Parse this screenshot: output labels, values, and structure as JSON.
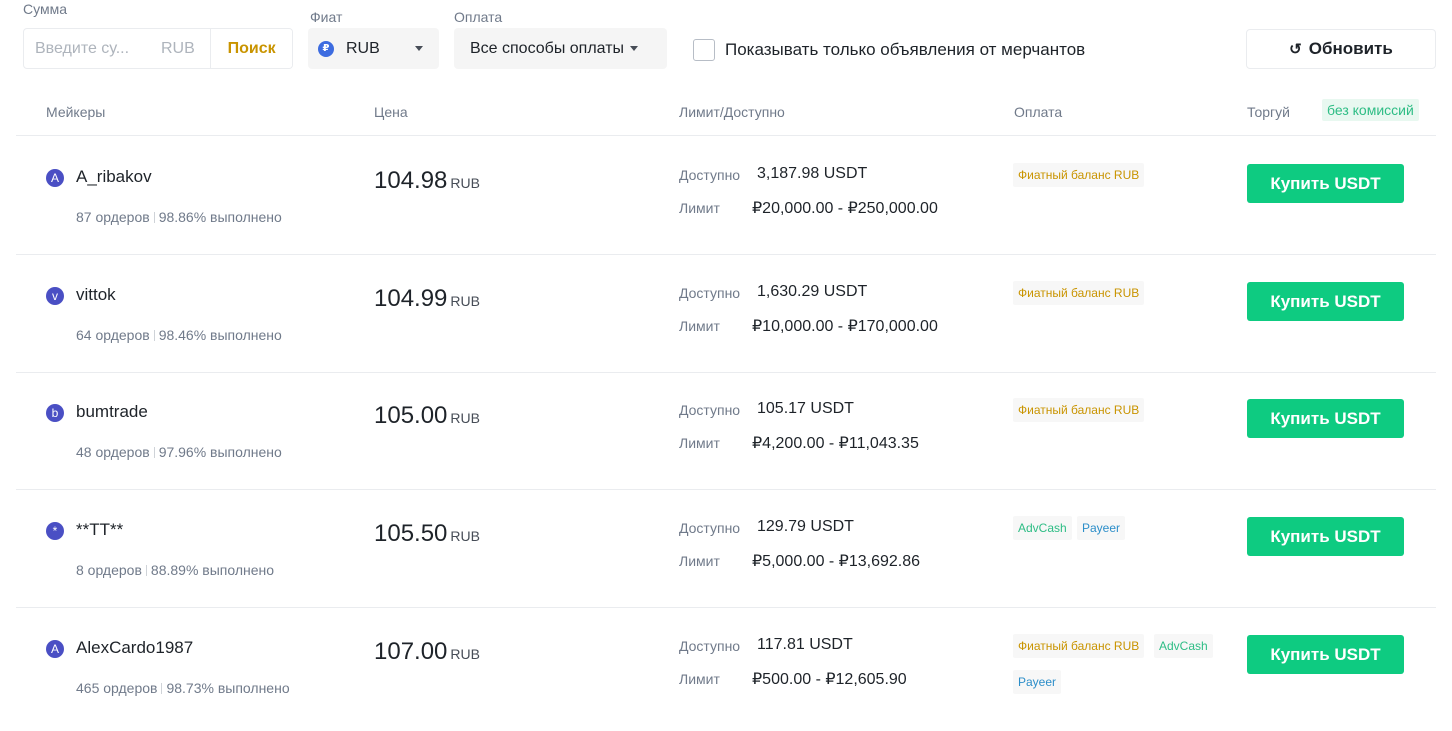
{
  "filters": {
    "amount_label": "Сумма",
    "amount_placeholder": "Введите су...",
    "amount_unit": "RUB",
    "search_label": "Поиск",
    "fiat_label": "Фиат",
    "fiat_value": "RUB",
    "fiat_icon_glyph": "₽",
    "payment_label": "Оплата",
    "payment_value": "Все способы оплаты",
    "merchant_only_label": "Показывать только объявления от мерчантов",
    "merchant_only_checked": false,
    "refresh_label": "Обновить",
    "refresh_icon": "refresh-icon"
  },
  "table": {
    "headers": {
      "makers": "Мейкеры",
      "price": "Цена",
      "limit": "Лимит/Доступно",
      "payment": "Оплата",
      "trade": "Торгуй",
      "no_fee": "без комиссий"
    },
    "available_label": "Доступно",
    "limit_label": "Лимит",
    "buy_label": "Купить USDT",
    "rows": [
      {
        "avatar": "A",
        "name": "A_ribakov",
        "orders": "87 ордеров",
        "completion": "98.86% выполнено",
        "price": "104.98",
        "currency": "RUB",
        "available": "3,187.98 USDT",
        "limit": "₽20,000.00 - ₽250,000.00",
        "payments": [
          "Фиатный баланс RUB"
        ]
      },
      {
        "avatar": "v",
        "name": "vittok",
        "orders": "64 ордеров",
        "completion": "98.46% выполнено",
        "price": "104.99",
        "currency": "RUB",
        "available": "1,630.29 USDT",
        "limit": "₽10,000.00 - ₽170,000.00",
        "payments": [
          "Фиатный баланс RUB"
        ]
      },
      {
        "avatar": "b",
        "name": "bumtrade",
        "orders": "48 ордеров",
        "completion": "97.96% выполнено",
        "price": "105.00",
        "currency": "RUB",
        "available": "105.17 USDT",
        "limit": "₽4,200.00 - ₽11,043.35",
        "payments": [
          "Фиатный баланс RUB"
        ]
      },
      {
        "avatar": "*",
        "name": "**TT**",
        "orders": "8 ордеров",
        "completion": "88.89% выполнено",
        "price": "105.50",
        "currency": "RUB",
        "available": "129.79 USDT",
        "limit": "₽5,000.00 - ₽13,692.86",
        "payments": [
          "AdvCash",
          "Payeer"
        ]
      },
      {
        "avatar": "A",
        "name": "AlexCardo1987",
        "orders": "465 ордеров",
        "completion": "98.73% выполнено",
        "price": "107.00",
        "currency": "RUB",
        "available": "117.81 USDT",
        "limit": "₽500.00 - ₽12,605.90",
        "payments": [
          "Фиатный баланс RUB",
          "AdvCash",
          "Payeer"
        ]
      }
    ]
  },
  "colors": {
    "buy_button": "#0ecb81",
    "search_accent": "#c99400",
    "avatar": "#4a4fc4",
    "tag_fiat": "#c99400",
    "tag_advcash": "#2ebd85",
    "tag_payeer": "#2c8ec9"
  }
}
